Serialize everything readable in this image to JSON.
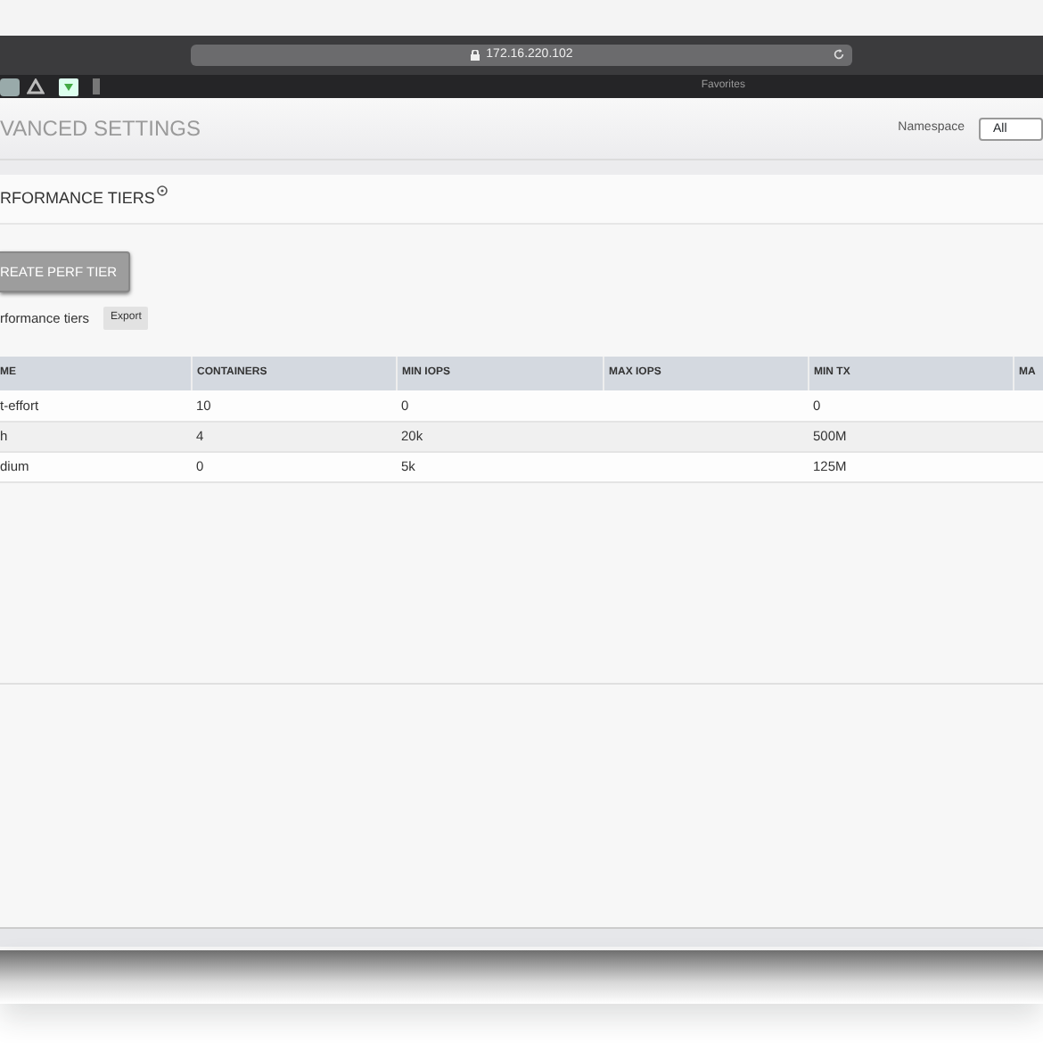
{
  "browser": {
    "url": "172.16.220.102",
    "favorites_label": "Favorites"
  },
  "header": {
    "title": "VANCED SETTINGS",
    "namespace_label": "Namespace",
    "namespace_value": "All"
  },
  "section": {
    "title": "RFORMANCE TIERS"
  },
  "create_button": "REATE PERF TIER",
  "list_label": "rformance tiers",
  "export_button": "Export",
  "table": {
    "columns": [
      "ME",
      "CONTAINERS",
      "MIN IOPS",
      "MAX IOPS",
      "MIN TX",
      "MA"
    ],
    "rows": [
      [
        "t-effort",
        "10",
        "0",
        "",
        "0",
        ""
      ],
      [
        "h",
        "4",
        "20k",
        "",
        "500M",
        ""
      ],
      [
        "dium",
        "0",
        "5k",
        "",
        "125M",
        ""
      ]
    ]
  }
}
